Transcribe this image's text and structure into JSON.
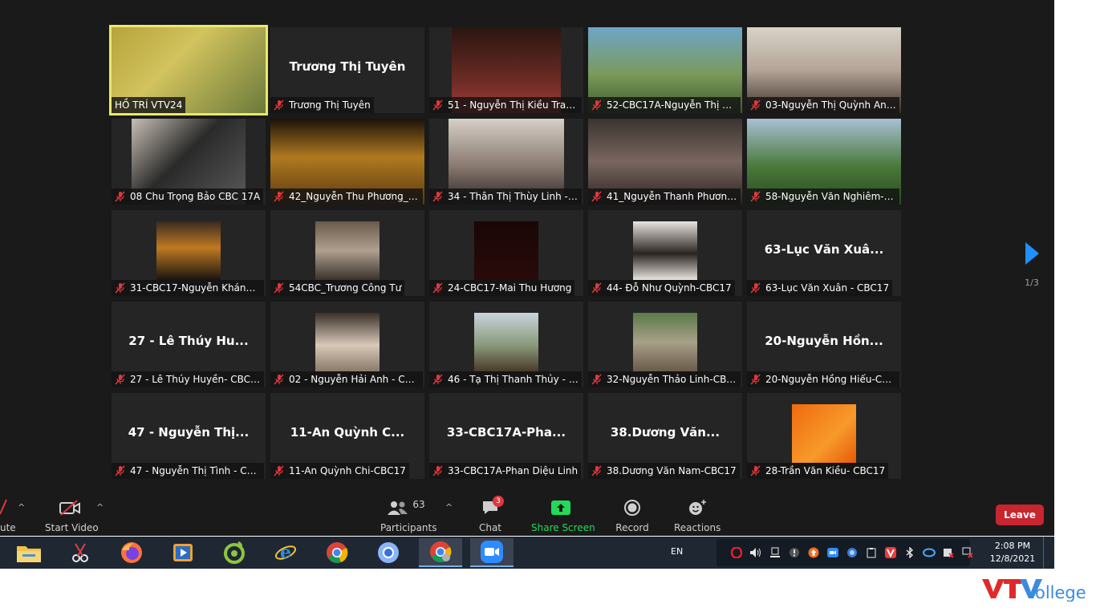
{
  "meeting": {
    "page_indicator": "1/3",
    "tiles": [
      {
        "label": "HỒ TRÍ VTV24",
        "type": "video",
        "active": true,
        "muted": false
      },
      {
        "label": "Trương Thị Tuyên",
        "big_name": "Trương Thị Tuyên",
        "type": "name",
        "muted": true
      },
      {
        "label": "51 - Nguyễn Thị Kiều Tran...",
        "type": "video",
        "muted": true
      },
      {
        "label": "52-CBC17A-Nguyễn Thị Th...",
        "type": "video",
        "muted": true
      },
      {
        "label": "03-Nguyễn Thị Quỳnh Anh-...",
        "type": "video",
        "muted": true
      },
      {
        "label": "08 Chu Trọng Bảo CBC 17A",
        "type": "video",
        "muted": true
      },
      {
        "label": "42_Nguyễn Thu Phương_CB...",
        "type": "video",
        "muted": true
      },
      {
        "label": "34 - Thân Thị Thùy Linh - C...",
        "type": "video",
        "muted": true
      },
      {
        "label": "41_Nguyễn Thanh Phương_...",
        "type": "video",
        "muted": true
      },
      {
        "label": "58-Nguyễn Văn Nghiêm-C...",
        "type": "video",
        "muted": true
      },
      {
        "label": "31-CBC17-Nguyễn Khánh L...",
        "type": "photo",
        "muted": true
      },
      {
        "label": "54CBC_Trương Công Tư",
        "type": "photo",
        "muted": true
      },
      {
        "label": "24-CBC17-Mai Thu Hương",
        "type": "photo",
        "muted": true
      },
      {
        "label": "44- Đỗ Như Quỳnh-CBC17",
        "type": "photo",
        "muted": true
      },
      {
        "label": "63-Lục Văn Xuân - CBC17",
        "big_name": "63-Lục Văn Xuâ...",
        "type": "name",
        "muted": true
      },
      {
        "label": "27 - Lê Thúy Huyền- CBC17",
        "big_name": "27 - Lê Thúy Hu...",
        "type": "name",
        "muted": true
      },
      {
        "label": "02 - Nguyễn Hải Anh - CBC...",
        "type": "photo",
        "muted": true
      },
      {
        "label": "46 - Tạ Thị Thanh Thủy - C...",
        "type": "photo",
        "muted": true
      },
      {
        "label": "32-Nguyễn Thảo Linh-CBC17",
        "type": "photo",
        "muted": true
      },
      {
        "label": "20-Nguyễn Hồng Hiếu-CBC...",
        "big_name": "20-Nguyễn Hồn...",
        "type": "name",
        "muted": true
      },
      {
        "label": "47 - Nguyễn Thị Tình - CBC...",
        "big_name": "47 - Nguyễn Thị...",
        "type": "name",
        "muted": true
      },
      {
        "label": "11-An Quỳnh Chi-CBC17",
        "big_name": "11-An Quỳnh C...",
        "type": "name",
        "muted": true
      },
      {
        "label": "33-CBC17A-Phan Diệu Linh",
        "big_name": "33-CBC17A-Pha...",
        "type": "name",
        "muted": true
      },
      {
        "label": "38.Dương Văn Nam-CBC17",
        "big_name": "38.Dương Văn...",
        "type": "name",
        "muted": true
      },
      {
        "label": "28-Trần Văn Kiều- CBC17",
        "type": "photo",
        "muted": true
      }
    ]
  },
  "toolbar": {
    "mute_label": "ute",
    "start_video_label": "Start Video",
    "participants_count": "63",
    "participants_label": "Participants",
    "chat_label": "Chat",
    "chat_badge": "3",
    "share_label": "Share Screen",
    "record_label": "Record",
    "reactions_label": "Reactions",
    "leave_label": "Leave"
  },
  "taskbar": {
    "language": "EN",
    "time": "2:08 PM",
    "date": "12/8/2021"
  },
  "colors": {
    "share_green": "#23d959",
    "leave_red": "#c7252f",
    "active_speaker": "#e9e96d",
    "muted_red": "#e0383e"
  }
}
